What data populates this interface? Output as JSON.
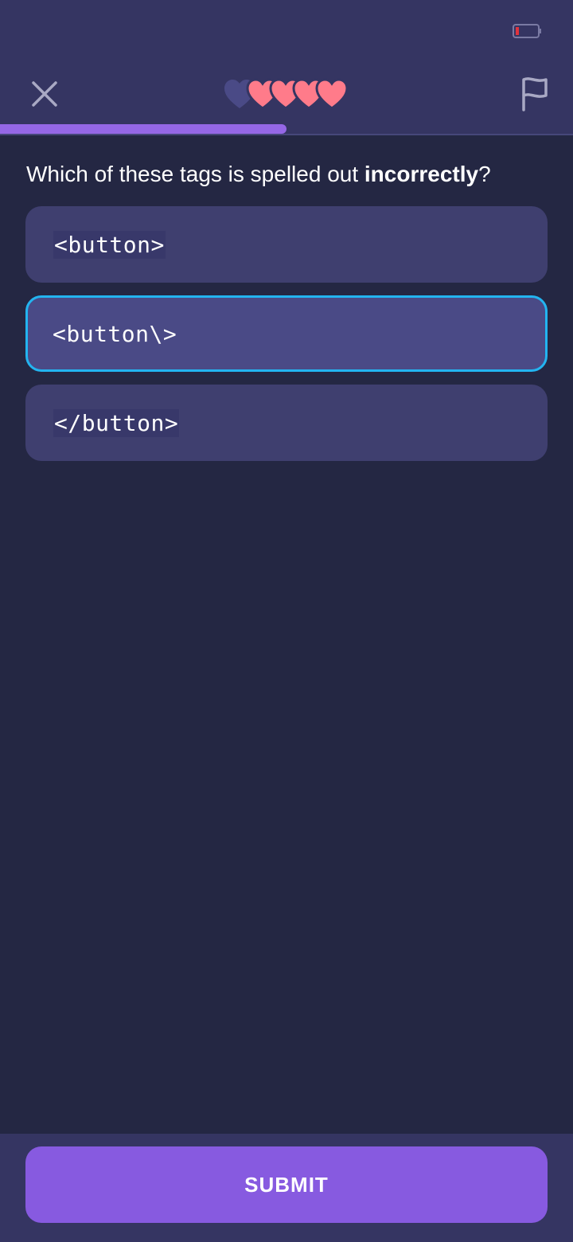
{
  "colors": {
    "header_bg": "#353562",
    "body_bg": "#242743",
    "option_bg": "#3f3f6f",
    "selected_border": "#23b4f0",
    "accent": "#875ae0",
    "progress": "#9567e6",
    "heart_full": "#ff7b8a",
    "heart_empty": "#4a4a86",
    "battery_low": "#e0333d"
  },
  "status_bar": {
    "battery_icon": "battery-low-icon"
  },
  "header": {
    "close_icon": "close-icon",
    "flag_icon": "flag-icon",
    "hearts": {
      "total": 5,
      "full": 4,
      "empty": 1
    },
    "progress_fraction": 0.5
  },
  "question": {
    "prefix": "Which of these tags is spelled out ",
    "emphasis": "incorrectly",
    "suffix": "?"
  },
  "options": [
    {
      "code": "<button>",
      "selected": false
    },
    {
      "code": "<button\\>",
      "selected": true
    },
    {
      "code": "</button>",
      "selected": false
    }
  ],
  "footer": {
    "submit_label": "SUBMIT"
  }
}
